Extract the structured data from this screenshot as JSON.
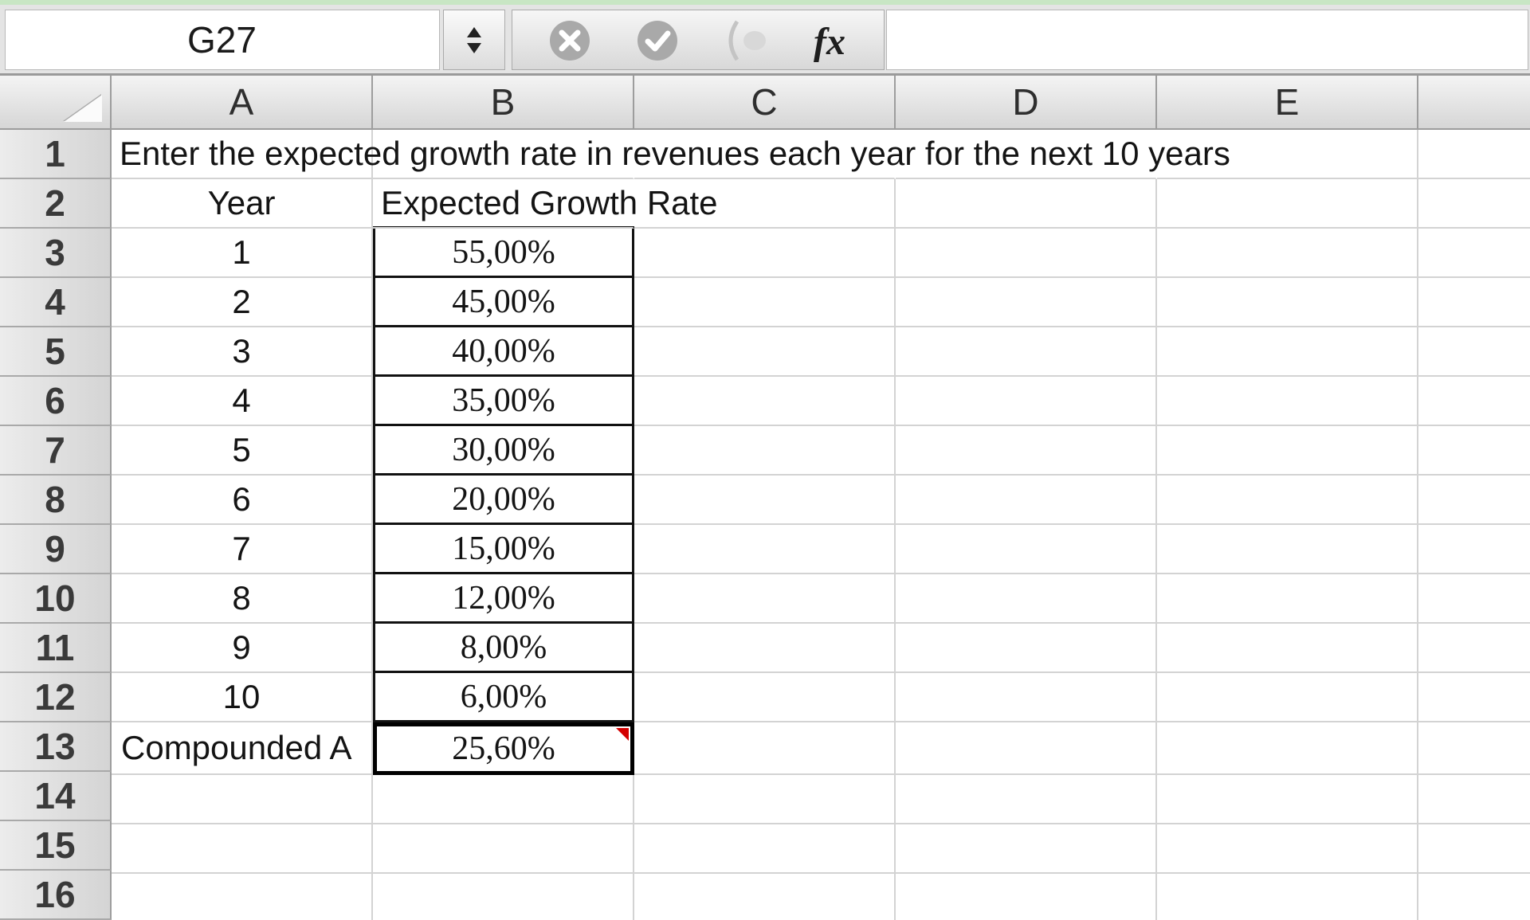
{
  "formula_bar": {
    "name_box": "G27",
    "fx_label": "fx",
    "formula": "",
    "icons": [
      "cancel-icon",
      "enter-check-icon",
      "function-wizard-icon"
    ]
  },
  "columns": [
    "A",
    "B",
    "C",
    "D",
    "E"
  ],
  "rows": [
    {
      "num": "1",
      "a": "Enter the expected growth rate in revenues each year for the next 10 years",
      "b": ""
    },
    {
      "num": "2",
      "a": "Year",
      "b": "Expected Growth Rate"
    },
    {
      "num": "3",
      "a": "1",
      "b": "55,00%"
    },
    {
      "num": "4",
      "a": "2",
      "b": "45,00%"
    },
    {
      "num": "5",
      "a": "3",
      "b": "40,00%"
    },
    {
      "num": "6",
      "a": "4",
      "b": "35,00%"
    },
    {
      "num": "7",
      "a": "5",
      "b": "30,00%"
    },
    {
      "num": "8",
      "a": "6",
      "b": "20,00%"
    },
    {
      "num": "9",
      "a": "7",
      "b": "15,00%"
    },
    {
      "num": "10",
      "a": "8",
      "b": "12,00%"
    },
    {
      "num": "11",
      "a": "9",
      "b": "8,00%"
    },
    {
      "num": "12",
      "a": "10",
      "b": "6,00%"
    },
    {
      "num": "13",
      "a": "Compounded A",
      "b": "25,60%"
    },
    {
      "num": "14",
      "a": "",
      "b": ""
    },
    {
      "num": "15",
      "a": "",
      "b": ""
    },
    {
      "num": "16",
      "a": "",
      "b": ""
    }
  ],
  "colors": {
    "comment_flag": "#d40000",
    "header_bg": "#d6d6d6",
    "grid_line": "#d3d3d3"
  }
}
